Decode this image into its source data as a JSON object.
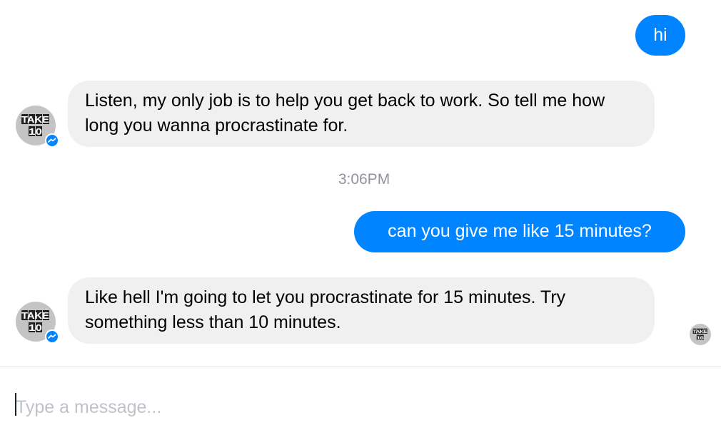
{
  "messages": [
    {
      "direction": "outgoing",
      "text": "hi"
    },
    {
      "direction": "incoming",
      "text": "Listen, my only job is to help you get back to work. So tell me how long you wanna procrastinate for."
    },
    {
      "direction": "outgoing",
      "text": "can you give me like 15 minutes?"
    },
    {
      "direction": "incoming",
      "text": "Like hell I'm going to let you procrastinate for 15 minutes. Try something less than 10 minutes."
    }
  ],
  "timestamp": "3:06PM",
  "avatar": {
    "logo_line1": "TAKE",
    "logo_line2": "10",
    "badge_icon": "messenger-icon"
  },
  "composer": {
    "placeholder": "Type a message...",
    "value": ""
  },
  "colors": {
    "outgoing_bubble": "#0084ff",
    "incoming_bubble": "#f1f0f0",
    "timestamp_text": "#90949c",
    "placeholder_text": "#bec3c9"
  }
}
